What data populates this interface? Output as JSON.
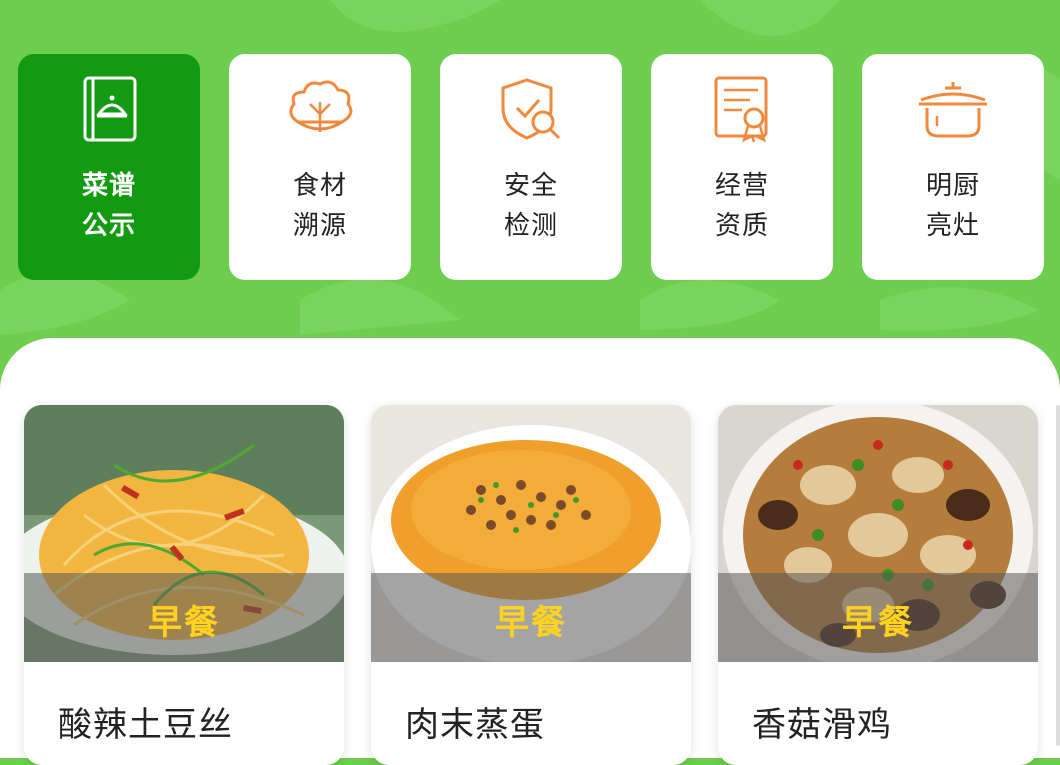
{
  "nav": {
    "items": [
      {
        "label_line1": "菜谱",
        "label_line2": "公示",
        "icon": "recipe-book-icon",
        "active": true
      },
      {
        "label_line1": "食材",
        "label_line2": "溯源",
        "icon": "cabbage-icon",
        "active": false
      },
      {
        "label_line1": "安全",
        "label_line2": "检测",
        "icon": "shield-search-icon",
        "active": false
      },
      {
        "label_line1": "经营",
        "label_line2": "资质",
        "icon": "certificate-icon",
        "active": false
      },
      {
        "label_line1": "明厨",
        "label_line2": "亮灶",
        "icon": "cooking-pot-icon",
        "active": false
      }
    ]
  },
  "colors": {
    "background": "#6ccd4f",
    "active_tile": "#129a12",
    "icon_orange": "#f0893c",
    "tag_yellow": "#ffd21f"
  },
  "dishes": [
    {
      "name": "酸辣土豆丝",
      "tag": "早餐"
    },
    {
      "name": "肉末蒸蛋",
      "tag": "早餐"
    },
    {
      "name": "香菇滑鸡",
      "tag": "早餐"
    }
  ]
}
